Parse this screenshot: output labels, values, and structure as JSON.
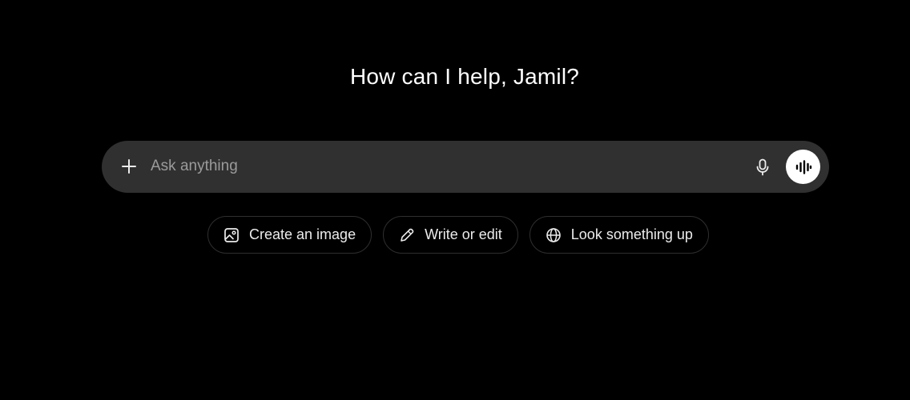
{
  "header": {
    "greeting": "How can I help, Jamil?"
  },
  "composer": {
    "placeholder": "Ask anything",
    "value": "",
    "add_icon": "plus-icon",
    "mic_icon": "microphone-icon",
    "voice_icon": "voice-mode-icon"
  },
  "suggestions": [
    {
      "label": "Create an image",
      "icon": "image-icon"
    },
    {
      "label": "Write or edit",
      "icon": "pencil-icon"
    },
    {
      "label": "Look something up",
      "icon": "globe-icon"
    }
  ],
  "colors": {
    "background": "#000000",
    "composer_bg": "#303030",
    "chip_border": "#2f2f2f",
    "text": "#ececec",
    "placeholder": "#9b9b9b"
  }
}
